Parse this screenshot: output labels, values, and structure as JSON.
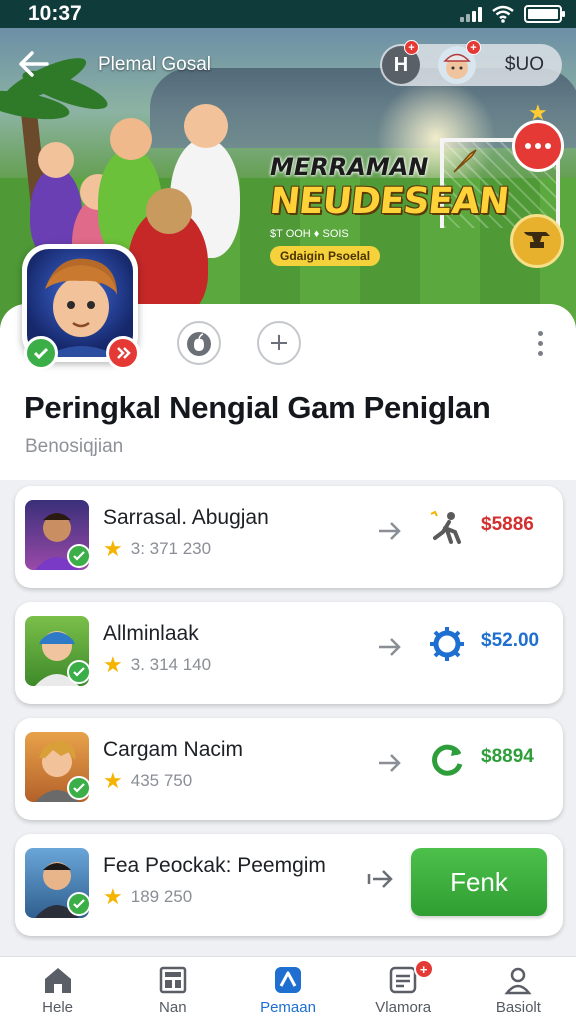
{
  "status_bar": {
    "time": "10:37"
  },
  "header": {
    "title": "Plemal Gosal",
    "coins": "$UO",
    "h_button_label": "H",
    "h_badge": "+",
    "avatar_badge": "+"
  },
  "banner": {
    "line1": "MERRAMAN",
    "line2": "NEUDESEAN",
    "line3": "$T OOH ♦ SOIS",
    "pill": "Gdaigin Psoelal"
  },
  "profile": {
    "title": "Peringkal Nengial Gam Peniglan",
    "subtitle": "Benosiqjian"
  },
  "list": [
    {
      "name": "Sarrasal. Abugjan",
      "score": "3: 371 230",
      "price": "$5886",
      "price_color": "#d32f2f",
      "icon": "running-man-icon"
    },
    {
      "name": "Allminlaak",
      "score": "3. 314 140",
      "price": "$52.00",
      "price_color": "#1e6fd0",
      "icon": "gear-badge-icon"
    },
    {
      "name": "Cargam Nacim",
      "score": "435 750",
      "price": "$8894",
      "price_color": "#2e9e3a",
      "icon": "refresh-icon"
    },
    {
      "name": "Fea Peockak: Peemgim",
      "score": "189 250",
      "cta": "Fenk"
    }
  ],
  "nav": {
    "items": [
      {
        "label": "Hele",
        "icon": "home-icon"
      },
      {
        "label": "Nan",
        "icon": "news-icon"
      },
      {
        "label": "Pemaan",
        "icon": "play-icon"
      },
      {
        "label": "Vlamora",
        "icon": "messages-icon",
        "badge": "+"
      },
      {
        "label": "Basiolt",
        "icon": "profile-icon"
      }
    ],
    "active_index": 2
  },
  "colors": {
    "accent": "#1e6fd0",
    "success": "#3cae48",
    "danger": "#e53935",
    "status_bar": "#0f3b3b"
  }
}
